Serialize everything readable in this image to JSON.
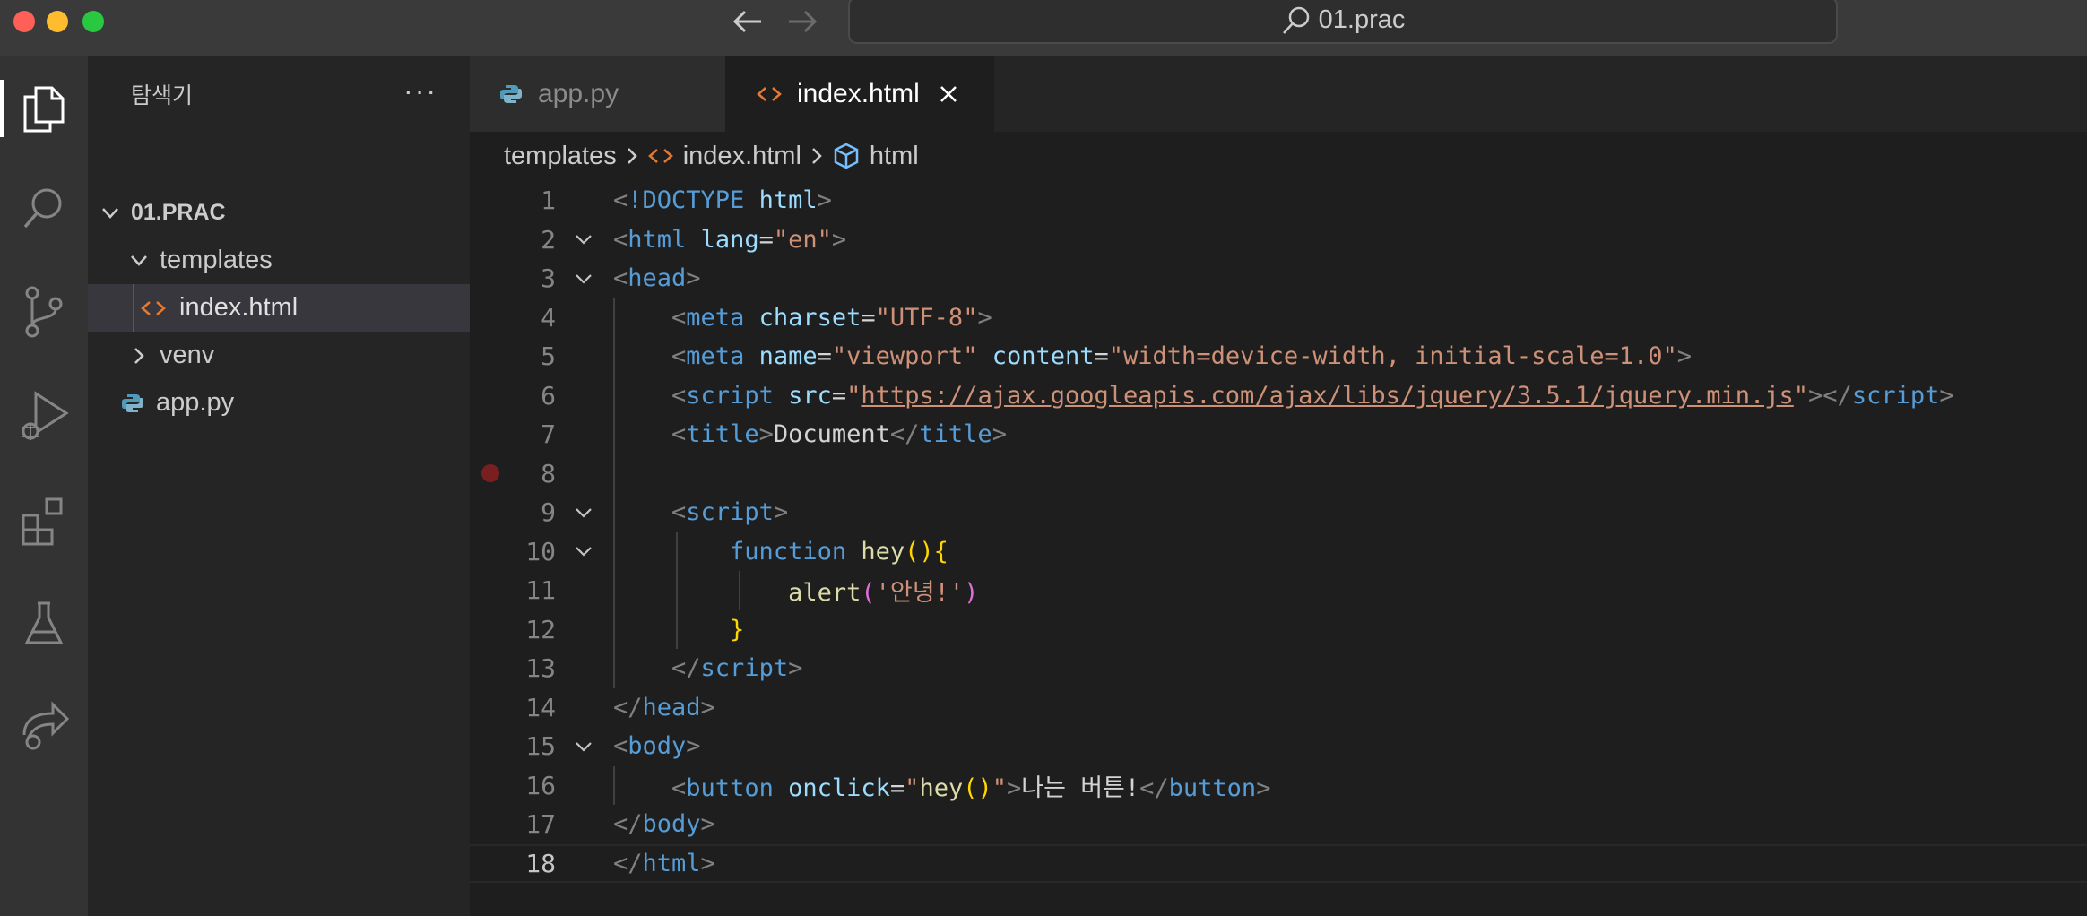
{
  "window": {
    "command_center_label": "01.prac"
  },
  "sidebar": {
    "title": "탐색기",
    "more_label": "···",
    "root": "01.PRAC",
    "items": [
      {
        "label": "templates"
      },
      {
        "label": "index.html"
      },
      {
        "label": "venv"
      },
      {
        "label": "app.py"
      }
    ]
  },
  "tabs": [
    {
      "label": "app.py"
    },
    {
      "label": "index.html"
    }
  ],
  "breadcrumb": [
    "templates",
    "index.html",
    "html"
  ],
  "editor": {
    "line_numbers": [
      "1",
      "2",
      "3",
      "4",
      "5",
      "6",
      "7",
      "8",
      "9",
      "10",
      "11",
      "12",
      "13",
      "14",
      "15",
      "16",
      "17",
      "18"
    ],
    "current_line": "18",
    "breakpoint_line": "8",
    "tokens": {
      "doctype_kw": "!DOCTYPE",
      "html": "html",
      "lang_attr": "lang",
      "lang_val": "\"en\"",
      "head": "head",
      "meta": "meta",
      "charset_attr": "charset",
      "charset_val": "\"UTF-8\"",
      "name_attr": "name",
      "name_val": "\"viewport\"",
      "content_attr": "content",
      "content_val": "\"width=device-width, initial-scale=1.0\"",
      "script": "script",
      "src_attr": "src",
      "src_url": "https://ajax.googleapis.com/ajax/libs/jquery/3.5.1/jquery.min.js",
      "title": "title",
      "title_text": "Document",
      "function_kw": "function",
      "fn_name": "hey",
      "alert": "alert",
      "alert_arg": "'안녕!'",
      "body": "body",
      "button": "button",
      "onclick_attr": "onclick",
      "onclick_q": "\"",
      "onclick_fn": "hey",
      "button_text": "나는 버튼!"
    }
  },
  "colors": {
    "tag_bracket": "#808080",
    "tag_name": "#569cd6",
    "attribute": "#9cdcfe",
    "string": "#ce9178",
    "function": "#dcdcaa",
    "bracket_gold": "#ffd700",
    "bracket_pink": "#da70d6",
    "html_file_icon": "#e37933",
    "python_icon": "#519aba"
  }
}
